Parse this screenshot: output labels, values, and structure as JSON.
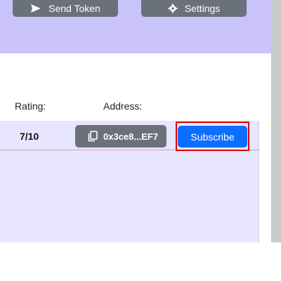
{
  "toolbar": {
    "send_token_label": "Send Token",
    "settings_label": "Settings"
  },
  "table": {
    "headers": {
      "rating": "Rating:",
      "address": "Address:"
    },
    "row": {
      "rating": "7/10",
      "address": "0x3ce8...EF7",
      "subscribe_label": "Subscribe"
    }
  },
  "icons": {
    "send": "send-icon",
    "settings": "gear-icon",
    "copy": "copy-icon"
  },
  "colors": {
    "topbar": "#c9c2fb",
    "row_background": "#e8e6fe",
    "primary": "#0d6efd",
    "secondary": "#6b717a",
    "highlight": "#e00000"
  }
}
